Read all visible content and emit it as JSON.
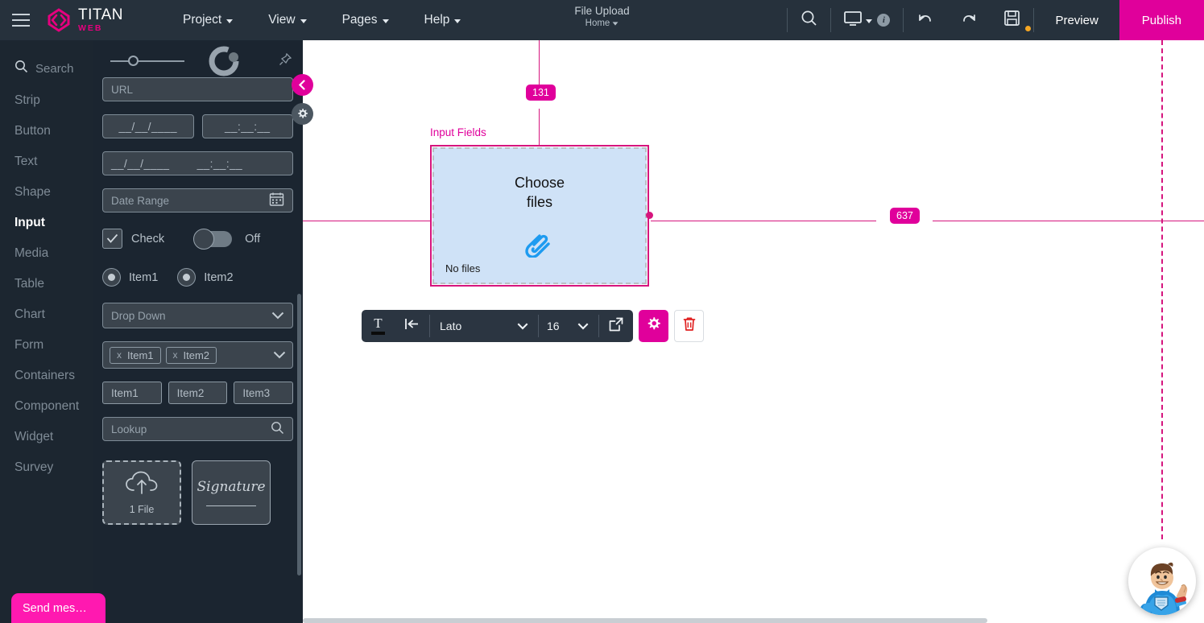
{
  "app": {
    "brand_name": "TITAN",
    "brand_sub": "WEB",
    "accent_pink": "#e0009b",
    "toolbar_dark": "#26313c",
    "panel_dark": "#1b2530",
    "guide_pink": "#d6157e",
    "element_fill": "#cfe2f7"
  },
  "topbar": {
    "menus": [
      {
        "label": "Project"
      },
      {
        "label": "View"
      },
      {
        "label": "Pages"
      },
      {
        "label": "Help"
      }
    ],
    "document_title": "File Upload",
    "document_page": "Home",
    "search_icon": "search-icon",
    "device_icon": "monitor-icon",
    "info_badge": "i",
    "undo_icon": "undo-icon",
    "redo_icon": "redo-icon",
    "save_icon": "save-icon",
    "preview_label": "Preview",
    "publish_label": "Publish"
  },
  "leftnav": {
    "search_placeholder": "Search",
    "items": [
      {
        "label": "Strip",
        "active": false
      },
      {
        "label": "Button",
        "active": false
      },
      {
        "label": "Text",
        "active": false
      },
      {
        "label": "Shape",
        "active": false
      },
      {
        "label": "Input",
        "active": true
      },
      {
        "label": "Media",
        "active": false
      },
      {
        "label": "Table",
        "active": false
      },
      {
        "label": "Chart",
        "active": false
      },
      {
        "label": "Form",
        "active": false
      },
      {
        "label": "Containers",
        "active": false
      },
      {
        "label": "Component",
        "active": false
      },
      {
        "label": "Widget",
        "active": false
      },
      {
        "label": "Survey",
        "active": false
      }
    ]
  },
  "panel": {
    "url_field": "URL",
    "date_field": "__/__/____",
    "time_field": "__:__:__",
    "datetime_field_date": "__/__/____",
    "datetime_field_time": "__:__:__",
    "date_range_field": "Date Range",
    "check_label": "Check",
    "toggle_label": "Off",
    "radio1_label": "Item1",
    "radio2_label": "Item2",
    "dropdown_label": "Drop Down",
    "multiselect_chips": [
      {
        "remove": "x",
        "label": "Item1"
      },
      {
        "remove": "x",
        "label": "Item2"
      }
    ],
    "button_group": [
      {
        "label": "Item1"
      },
      {
        "label": "Item2"
      },
      {
        "label": "Item3"
      }
    ],
    "lookup_field": "Lookup",
    "file_upload_label": "1 File",
    "signature_label": "Signature"
  },
  "canvas": {
    "guide_top_badge": "131",
    "guide_right_badge": "637",
    "element_label": "Input Fields",
    "choose_line1": "Choose",
    "choose_line2": "files",
    "attachment_icon": "paperclip-icon",
    "no_files_label": "No files"
  },
  "floating_toolbar": {
    "text_color_icon": "text-color-icon",
    "align_icon": "text-align-indent-icon",
    "font_family": "Lato",
    "font_size": "16",
    "open_icon": "open-external-icon",
    "settings_icon": "gear-icon",
    "delete_icon": "trash-icon"
  },
  "chat": {
    "send_label": "Send mes…",
    "avatar": "support-hero-avatar"
  }
}
